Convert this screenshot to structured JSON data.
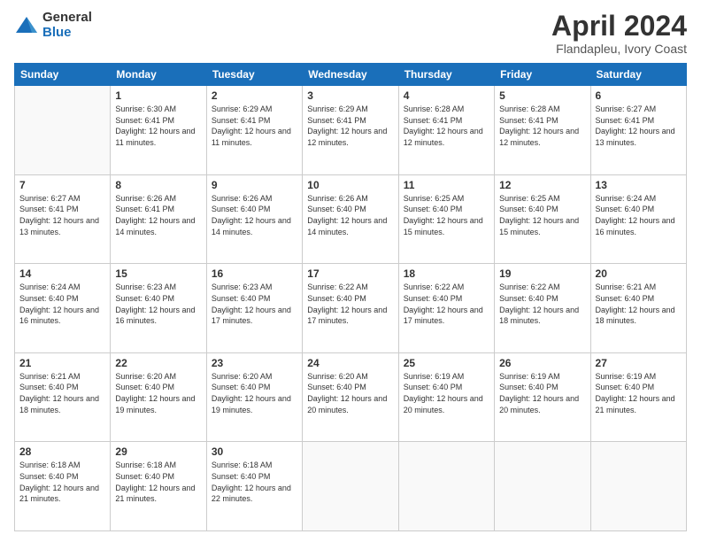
{
  "logo": {
    "general": "General",
    "blue": "Blue"
  },
  "title": "April 2024",
  "subtitle": "Flandapleu, Ivory Coast",
  "days_header": [
    "Sunday",
    "Monday",
    "Tuesday",
    "Wednesday",
    "Thursday",
    "Friday",
    "Saturday"
  ],
  "weeks": [
    [
      {
        "day": "",
        "info": ""
      },
      {
        "day": "1",
        "info": "Sunrise: 6:30 AM\nSunset: 6:41 PM\nDaylight: 12 hours and 11 minutes."
      },
      {
        "day": "2",
        "info": "Sunrise: 6:29 AM\nSunset: 6:41 PM\nDaylight: 12 hours and 11 minutes."
      },
      {
        "day": "3",
        "info": "Sunrise: 6:29 AM\nSunset: 6:41 PM\nDaylight: 12 hours and 12 minutes."
      },
      {
        "day": "4",
        "info": "Sunrise: 6:28 AM\nSunset: 6:41 PM\nDaylight: 12 hours and 12 minutes."
      },
      {
        "day": "5",
        "info": "Sunrise: 6:28 AM\nSunset: 6:41 PM\nDaylight: 12 hours and 12 minutes."
      },
      {
        "day": "6",
        "info": "Sunrise: 6:27 AM\nSunset: 6:41 PM\nDaylight: 12 hours and 13 minutes."
      }
    ],
    [
      {
        "day": "7",
        "info": "Sunrise: 6:27 AM\nSunset: 6:41 PM\nDaylight: 12 hours and 13 minutes."
      },
      {
        "day": "8",
        "info": "Sunrise: 6:26 AM\nSunset: 6:41 PM\nDaylight: 12 hours and 14 minutes."
      },
      {
        "day": "9",
        "info": "Sunrise: 6:26 AM\nSunset: 6:40 PM\nDaylight: 12 hours and 14 minutes."
      },
      {
        "day": "10",
        "info": "Sunrise: 6:26 AM\nSunset: 6:40 PM\nDaylight: 12 hours and 14 minutes."
      },
      {
        "day": "11",
        "info": "Sunrise: 6:25 AM\nSunset: 6:40 PM\nDaylight: 12 hours and 15 minutes."
      },
      {
        "day": "12",
        "info": "Sunrise: 6:25 AM\nSunset: 6:40 PM\nDaylight: 12 hours and 15 minutes."
      },
      {
        "day": "13",
        "info": "Sunrise: 6:24 AM\nSunset: 6:40 PM\nDaylight: 12 hours and 16 minutes."
      }
    ],
    [
      {
        "day": "14",
        "info": "Sunrise: 6:24 AM\nSunset: 6:40 PM\nDaylight: 12 hours and 16 minutes."
      },
      {
        "day": "15",
        "info": "Sunrise: 6:23 AM\nSunset: 6:40 PM\nDaylight: 12 hours and 16 minutes."
      },
      {
        "day": "16",
        "info": "Sunrise: 6:23 AM\nSunset: 6:40 PM\nDaylight: 12 hours and 17 minutes."
      },
      {
        "day": "17",
        "info": "Sunrise: 6:22 AM\nSunset: 6:40 PM\nDaylight: 12 hours and 17 minutes."
      },
      {
        "day": "18",
        "info": "Sunrise: 6:22 AM\nSunset: 6:40 PM\nDaylight: 12 hours and 17 minutes."
      },
      {
        "day": "19",
        "info": "Sunrise: 6:22 AM\nSunset: 6:40 PM\nDaylight: 12 hours and 18 minutes."
      },
      {
        "day": "20",
        "info": "Sunrise: 6:21 AM\nSunset: 6:40 PM\nDaylight: 12 hours and 18 minutes."
      }
    ],
    [
      {
        "day": "21",
        "info": "Sunrise: 6:21 AM\nSunset: 6:40 PM\nDaylight: 12 hours and 18 minutes."
      },
      {
        "day": "22",
        "info": "Sunrise: 6:20 AM\nSunset: 6:40 PM\nDaylight: 12 hours and 19 minutes."
      },
      {
        "day": "23",
        "info": "Sunrise: 6:20 AM\nSunset: 6:40 PM\nDaylight: 12 hours and 19 minutes."
      },
      {
        "day": "24",
        "info": "Sunrise: 6:20 AM\nSunset: 6:40 PM\nDaylight: 12 hours and 20 minutes."
      },
      {
        "day": "25",
        "info": "Sunrise: 6:19 AM\nSunset: 6:40 PM\nDaylight: 12 hours and 20 minutes."
      },
      {
        "day": "26",
        "info": "Sunrise: 6:19 AM\nSunset: 6:40 PM\nDaylight: 12 hours and 20 minutes."
      },
      {
        "day": "27",
        "info": "Sunrise: 6:19 AM\nSunset: 6:40 PM\nDaylight: 12 hours and 21 minutes."
      }
    ],
    [
      {
        "day": "28",
        "info": "Sunrise: 6:18 AM\nSunset: 6:40 PM\nDaylight: 12 hours and 21 minutes."
      },
      {
        "day": "29",
        "info": "Sunrise: 6:18 AM\nSunset: 6:40 PM\nDaylight: 12 hours and 21 minutes."
      },
      {
        "day": "30",
        "info": "Sunrise: 6:18 AM\nSunset: 6:40 PM\nDaylight: 12 hours and 22 minutes."
      },
      {
        "day": "",
        "info": ""
      },
      {
        "day": "",
        "info": ""
      },
      {
        "day": "",
        "info": ""
      },
      {
        "day": "",
        "info": ""
      }
    ]
  ]
}
